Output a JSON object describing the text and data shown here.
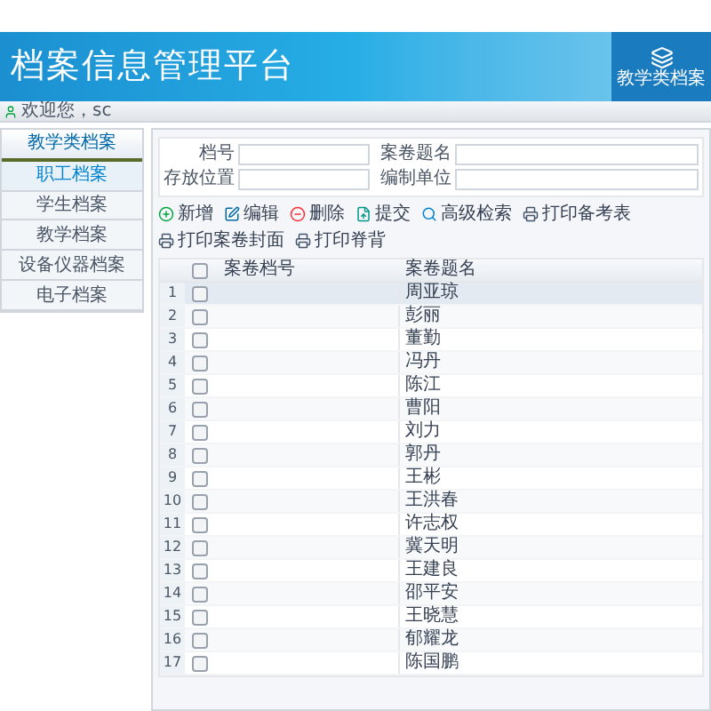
{
  "header": {
    "title": "档案信息管理平台",
    "badge_label": "教学类档案"
  },
  "welcome": "欢迎您，sc",
  "sidebar": {
    "title": "教学类档案",
    "items": [
      {
        "label": "职工档案",
        "selected": true
      },
      {
        "label": "学生档案",
        "selected": false
      },
      {
        "label": "教学档案",
        "selected": false
      },
      {
        "label": "设备仪器档案",
        "selected": false
      },
      {
        "label": "电子档案",
        "selected": false
      }
    ]
  },
  "search": {
    "fields": [
      {
        "label": "档号"
      },
      {
        "label": "案卷题名"
      },
      {
        "label": "存放位置"
      },
      {
        "label": "编制单位"
      }
    ]
  },
  "toolbar": [
    {
      "label": "新增",
      "kind": "add"
    },
    {
      "label": "编辑",
      "kind": "edit"
    },
    {
      "label": "删除",
      "kind": "delete"
    },
    {
      "label": "提交",
      "kind": "submit"
    },
    {
      "label": "高级检索",
      "kind": "search"
    },
    {
      "label": "打印备考表",
      "kind": "print"
    },
    {
      "label": "打印案卷封面",
      "kind": "print"
    },
    {
      "label": "打印脊背",
      "kind": "print"
    }
  ],
  "table": {
    "header_checked": false,
    "columns": [
      "案卷档号",
      "案卷题名"
    ],
    "rows": [
      {
        "number": "1",
        "title": "周亚琼",
        "checked": false,
        "selected": true
      },
      {
        "number": "2",
        "title": "彭丽",
        "checked": false,
        "selected": false
      },
      {
        "number": "3",
        "title": "董勤",
        "checked": false,
        "selected": false
      },
      {
        "number": "4",
        "title": "冯丹",
        "checked": false,
        "selected": false
      },
      {
        "number": "5",
        "title": "陈江",
        "checked": false,
        "selected": false
      },
      {
        "number": "6",
        "title": "曹阳",
        "checked": false,
        "selected": false
      },
      {
        "number": "7",
        "title": "刘力",
        "checked": false,
        "selected": false
      },
      {
        "number": "8",
        "title": "郭丹",
        "checked": false,
        "selected": false
      },
      {
        "number": "9",
        "title": "王彬",
        "checked": false,
        "selected": false
      },
      {
        "number": "10",
        "title": "王洪春",
        "checked": false,
        "selected": false
      },
      {
        "number": "11",
        "title": "许志权",
        "checked": false,
        "selected": false
      },
      {
        "number": "12",
        "title": "冀天明",
        "checked": false,
        "selected": false
      },
      {
        "number": "13",
        "title": "王建良",
        "checked": false,
        "selected": false
      },
      {
        "number": "14",
        "title": "邵平安",
        "checked": false,
        "selected": false
      },
      {
        "number": "15",
        "title": "王晓慧",
        "checked": false,
        "selected": false
      },
      {
        "number": "16",
        "title": "郁耀龙",
        "checked": false,
        "selected": false
      },
      {
        "number": "17",
        "title": "陈国鹏",
        "checked": false,
        "selected": false
      }
    ]
  }
}
